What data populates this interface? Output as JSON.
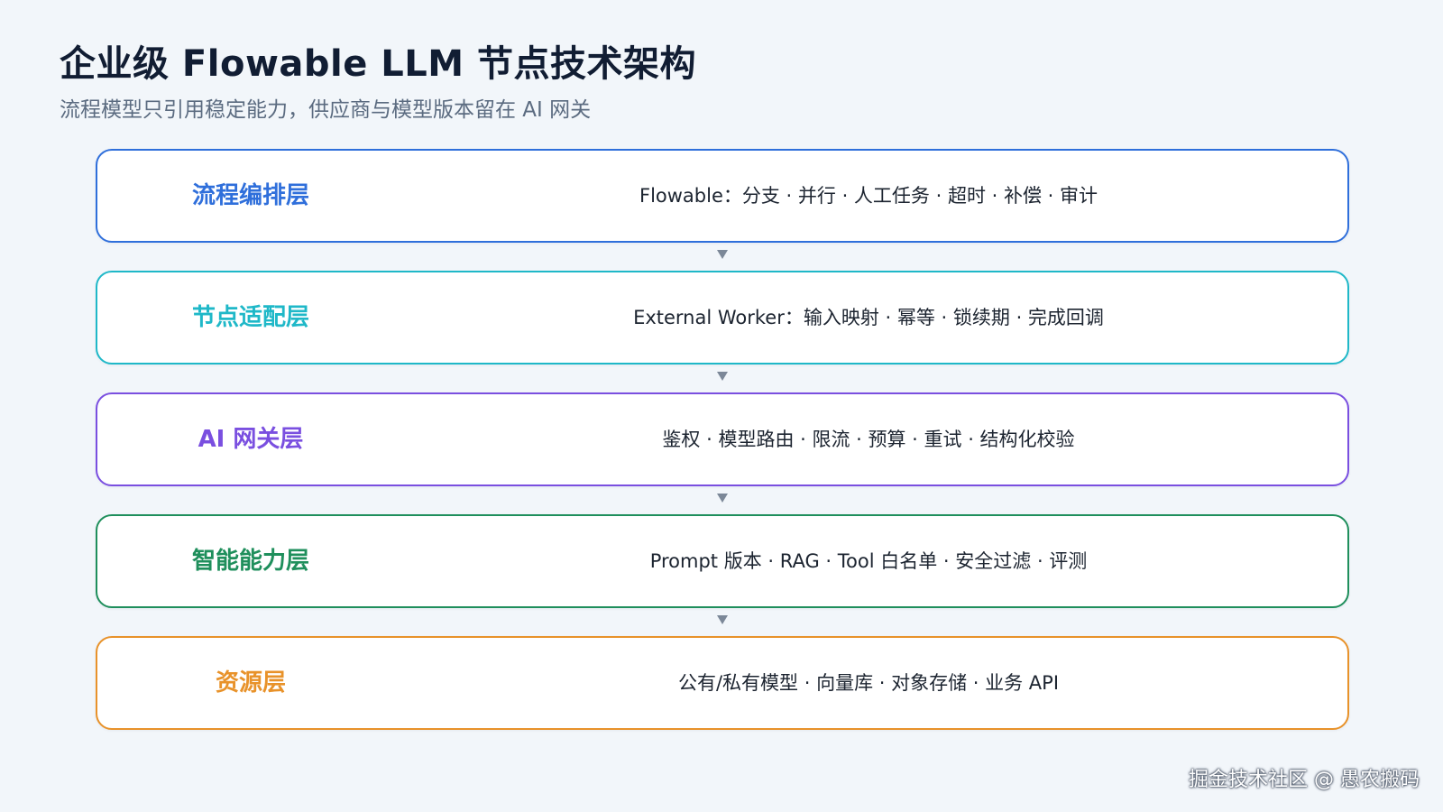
{
  "header": {
    "title": "企业级 Flowable LLM 节点技术架构",
    "subtitle": "流程模型只引用稳定能力，供应商与模型版本留在 AI 网关"
  },
  "layers": [
    {
      "name": "流程编排层",
      "description": "Flowable：分支 · 并行 · 人工任务 · 超时 · 补偿 · 审计",
      "color": "#2f6fdb"
    },
    {
      "name": "节点适配层",
      "description": "External Worker：输入映射 · 幂等 · 锁续期 · 完成回调",
      "color": "#1fb8c8"
    },
    {
      "name": "AI 网关层",
      "description": "鉴权 · 模型路由 · 限流 · 预算 · 重试 · 结构化校验",
      "color": "#7a4fe0"
    },
    {
      "name": "智能能力层",
      "description": "Prompt 版本 · RAG · Tool 白名单 · 安全过滤 · 评测",
      "color": "#1f8f5c"
    },
    {
      "name": "资源层",
      "description": "公有/私有模型 · 向量库 · 对象存储 · 业务 API",
      "color": "#e8922a"
    }
  ],
  "watermark": "掘金技术社区 @ 愚农搬码",
  "icons": {
    "connector": "arrow-down-icon"
  }
}
